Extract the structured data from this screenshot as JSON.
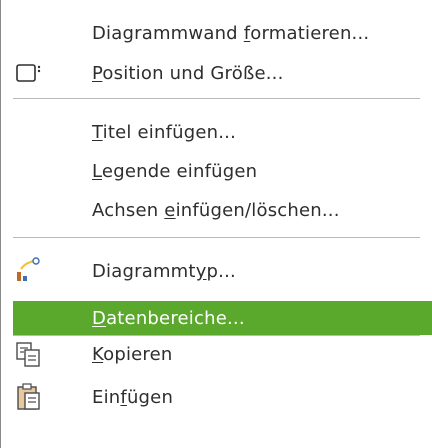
{
  "menu": {
    "items": [
      {
        "id": "wall",
        "pre": "Diagrammwand ",
        "u": "f",
        "post": "ormatieren...",
        "icon": null
      },
      {
        "id": "posize",
        "pre": "",
        "u": "P",
        "post": "osition und Größe...",
        "icon": "position-size-icon"
      },
      {
        "id": "title",
        "pre": "",
        "u": "T",
        "post": "itel einfügen...",
        "icon": null
      },
      {
        "id": "legend",
        "pre": "",
        "u": "L",
        "post": "egende einfügen",
        "icon": null
      },
      {
        "id": "axes",
        "pre": "Achsen ",
        "u": "e",
        "post": "infügen/löschen...",
        "icon": null
      },
      {
        "id": "charttype",
        "pre": "Diagrammt",
        "u": "y",
        "post": "p...",
        "icon": "chart-type-icon"
      },
      {
        "id": "datarange",
        "pre": "",
        "u": "D",
        "post": "atenbereiche...",
        "icon": null
      },
      {
        "id": "copy",
        "pre": "",
        "u": "K",
        "post": "opieren",
        "icon": "copy-icon"
      },
      {
        "id": "paste",
        "pre": "Ein",
        "u": "f",
        "post": "ügen",
        "icon": "paste-icon"
      }
    ],
    "highlight_color": "#5aa82c"
  }
}
